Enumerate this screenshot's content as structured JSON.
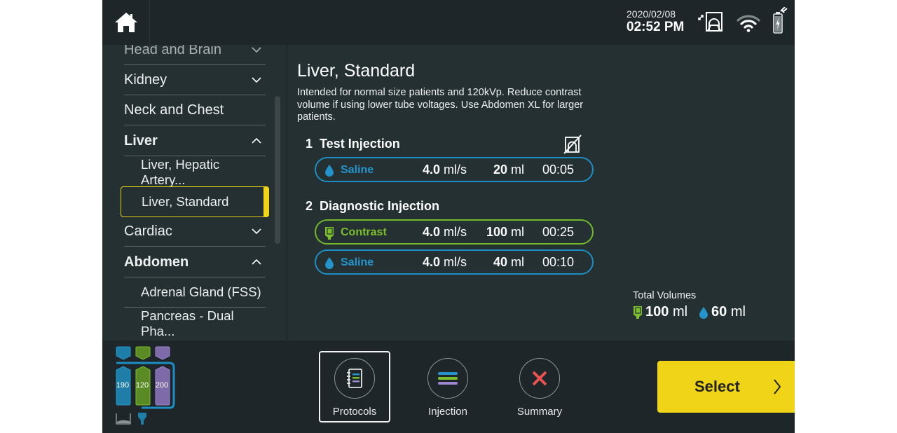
{
  "header": {
    "date": "2020/02/08",
    "time": "02:52 PM",
    "icons": [
      "home-icon",
      "scanner-link-icon",
      "wifi-icon",
      "battery-charging-icon"
    ]
  },
  "sidebar": {
    "items": [
      {
        "label": "Head and Brain",
        "type": "category",
        "expanded": false
      },
      {
        "label": "Kidney",
        "type": "category",
        "expanded": false
      },
      {
        "label": "Neck and Chest",
        "type": "category",
        "expanded": false
      },
      {
        "label": "Liver",
        "type": "category",
        "expanded": true
      },
      {
        "label": "Liver, Hepatic Artery...",
        "type": "protocol"
      },
      {
        "label": "Liver, Standard",
        "type": "protocol",
        "selected": true
      },
      {
        "label": "Cardiac",
        "type": "category",
        "expanded": false
      },
      {
        "label": "Abdomen",
        "type": "category",
        "expanded": true
      },
      {
        "label": "Adrenal Gland (FSS)",
        "type": "protocol"
      },
      {
        "label": "Pancreas - Dual Pha...",
        "type": "protocol"
      }
    ]
  },
  "protocol": {
    "title": "Liver, Standard",
    "description": "Intended for normal size patients and 120kVp. Reduce contrast volume if using lower tube voltages. Use Abdomen XL for larger patients.",
    "phases": [
      {
        "number": "1",
        "name": "Test Injection",
        "steps": [
          {
            "fluid": "Saline",
            "rate": "4.0",
            "rate_unit": "ml/s",
            "volume": "20",
            "volume_unit": "ml",
            "duration": "00:05"
          }
        ]
      },
      {
        "number": "2",
        "name": "Diagnostic Injection",
        "steps": [
          {
            "fluid": "Contrast",
            "rate": "4.0",
            "rate_unit": "ml/s",
            "volume": "100",
            "volume_unit": "ml",
            "duration": "00:25"
          },
          {
            "fluid": "Saline",
            "rate": "4.0",
            "rate_unit": "ml/s",
            "volume": "40",
            "volume_unit": "ml",
            "duration": "00:10"
          }
        ]
      }
    ],
    "totals": {
      "label": "Total Volumes",
      "contrast": "100",
      "saline": "60",
      "unit": "ml"
    }
  },
  "syringes": {
    "volumes": [
      "190",
      "120",
      "200"
    ],
    "colors": [
      "#1f7ea8",
      "#5a8a24",
      "#7e6aa8"
    ]
  },
  "bottom_nav": {
    "tabs": [
      {
        "label": "Protocols",
        "active": true
      },
      {
        "label": "Injection",
        "active": false
      },
      {
        "label": "Summary",
        "active": false
      }
    ],
    "select_label": "Select"
  },
  "colors": {
    "accent_yellow": "#f0d417",
    "saline_blue": "#2394cc",
    "contrast_green": "#7bc02c",
    "alert_red": "#e8524f",
    "purple": "#9b86d0"
  }
}
